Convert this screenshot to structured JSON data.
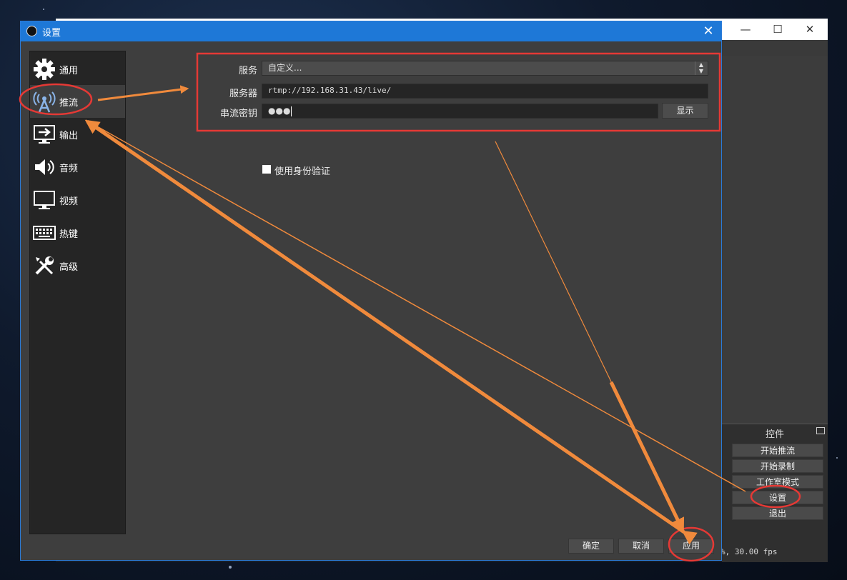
{
  "main_window": {
    "controls_panel": {
      "title": "控件",
      "buttons": [
        "开始推流",
        "开始录制",
        "工作室模式",
        "设置",
        "退出"
      ]
    },
    "status_fps": "%, 30.00 fps",
    "window_controls": {
      "minimize": "—",
      "maximize": "☐",
      "close": "✕"
    }
  },
  "dialog": {
    "title": "设置",
    "close_glyph": "✕",
    "sidebar": [
      {
        "label": "通用",
        "icon": "gear-icon"
      },
      {
        "label": "推流",
        "icon": "broadcast-antenna-icon",
        "active": true
      },
      {
        "label": "输出",
        "icon": "output-icon"
      },
      {
        "label": "音频",
        "icon": "speaker-icon"
      },
      {
        "label": "视频",
        "icon": "monitor-icon"
      },
      {
        "label": "热键",
        "icon": "keyboard-icon"
      },
      {
        "label": "高级",
        "icon": "tools-icon"
      }
    ],
    "stream": {
      "service_label": "服务",
      "service_value": "自定义...",
      "server_label": "服务器",
      "server_value": "rtmp://192.168.31.43/live/",
      "key_label": "串流密钥",
      "key_value": "●●●",
      "show_button": "显示",
      "auth_checkbox_label": "使用身份验证"
    },
    "footer": {
      "ok": "确定",
      "cancel": "取消",
      "apply": "应用"
    }
  },
  "colors": {
    "accent": "#1e78d7",
    "annotation_red": "#e53935",
    "annotation_orange": "#f08a3c"
  }
}
